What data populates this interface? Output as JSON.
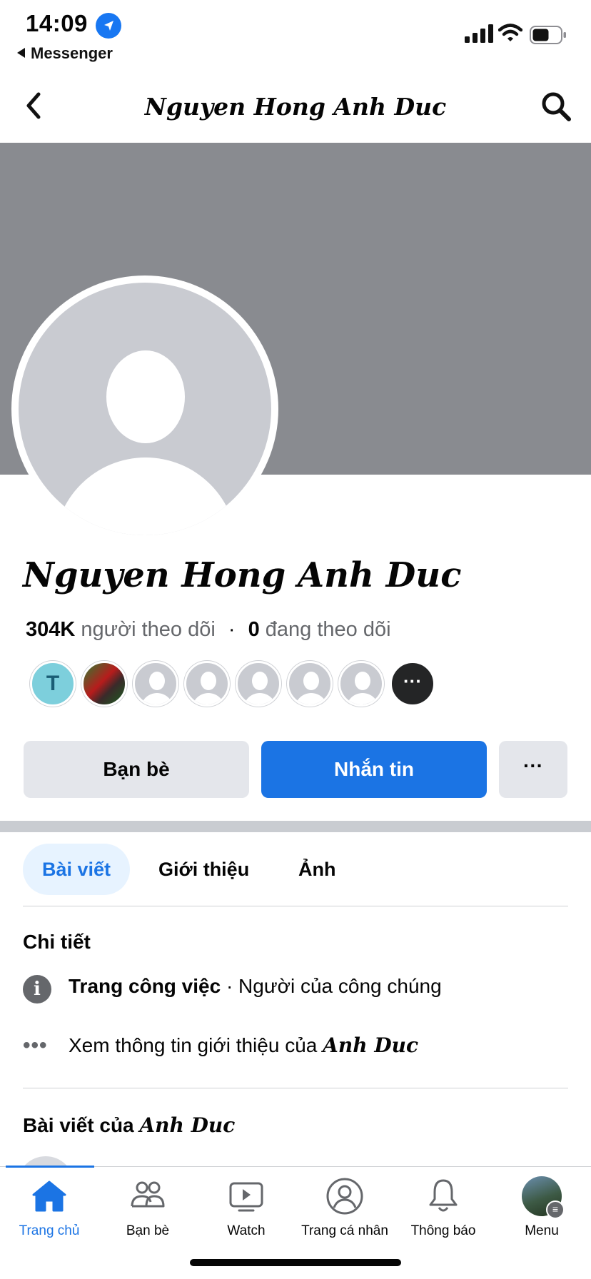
{
  "status_bar": {
    "time": "14:09",
    "back_app": "Messenger"
  },
  "header": {
    "title": "Nguyen Hong Anh Duc"
  },
  "profile": {
    "name": "Nguyen Hong Anh Duc",
    "followers_count": "304K",
    "followers_label": "người theo dõi",
    "separator": "·",
    "following_count": "0",
    "following_label": "đang theo dõi",
    "friend_initial": "T",
    "more_friends": "···"
  },
  "actions": {
    "friends": "Bạn bè",
    "message": "Nhắn tin",
    "more": "···"
  },
  "tabs": [
    {
      "label": "Bài viết"
    },
    {
      "label": "Giới thiệu"
    },
    {
      "label": "Ảnh"
    }
  ],
  "details": {
    "title": "Chi tiết",
    "page_type": "Trang công việc",
    "page_category": " · Người của công chúng",
    "see_about_prefix": "Xem thông tin giới thiệu của ",
    "see_about_name": "Anh Duc"
  },
  "posts": {
    "title_prefix": "Bài viết của ",
    "title_name": "Anh Duc"
  },
  "bottom_nav": [
    {
      "label": "Trang chủ"
    },
    {
      "label": "Bạn bè"
    },
    {
      "label": "Watch"
    },
    {
      "label": "Trang cá nhân"
    },
    {
      "label": "Thông báo"
    },
    {
      "label": "Menu"
    }
  ],
  "colors": {
    "brand_blue": "#1b74e4",
    "cover_gray": "#898b90",
    "tab_active_bg": "#e7f3ff"
  },
  "icons": [
    "location-arrow-icon",
    "signal-icon",
    "wifi-icon",
    "battery-icon",
    "back-chevron-icon",
    "search-icon",
    "info-icon",
    "more-dots-icon",
    "home-icon",
    "friends-icon",
    "watch-icon",
    "profile-icon",
    "bell-icon"
  ]
}
